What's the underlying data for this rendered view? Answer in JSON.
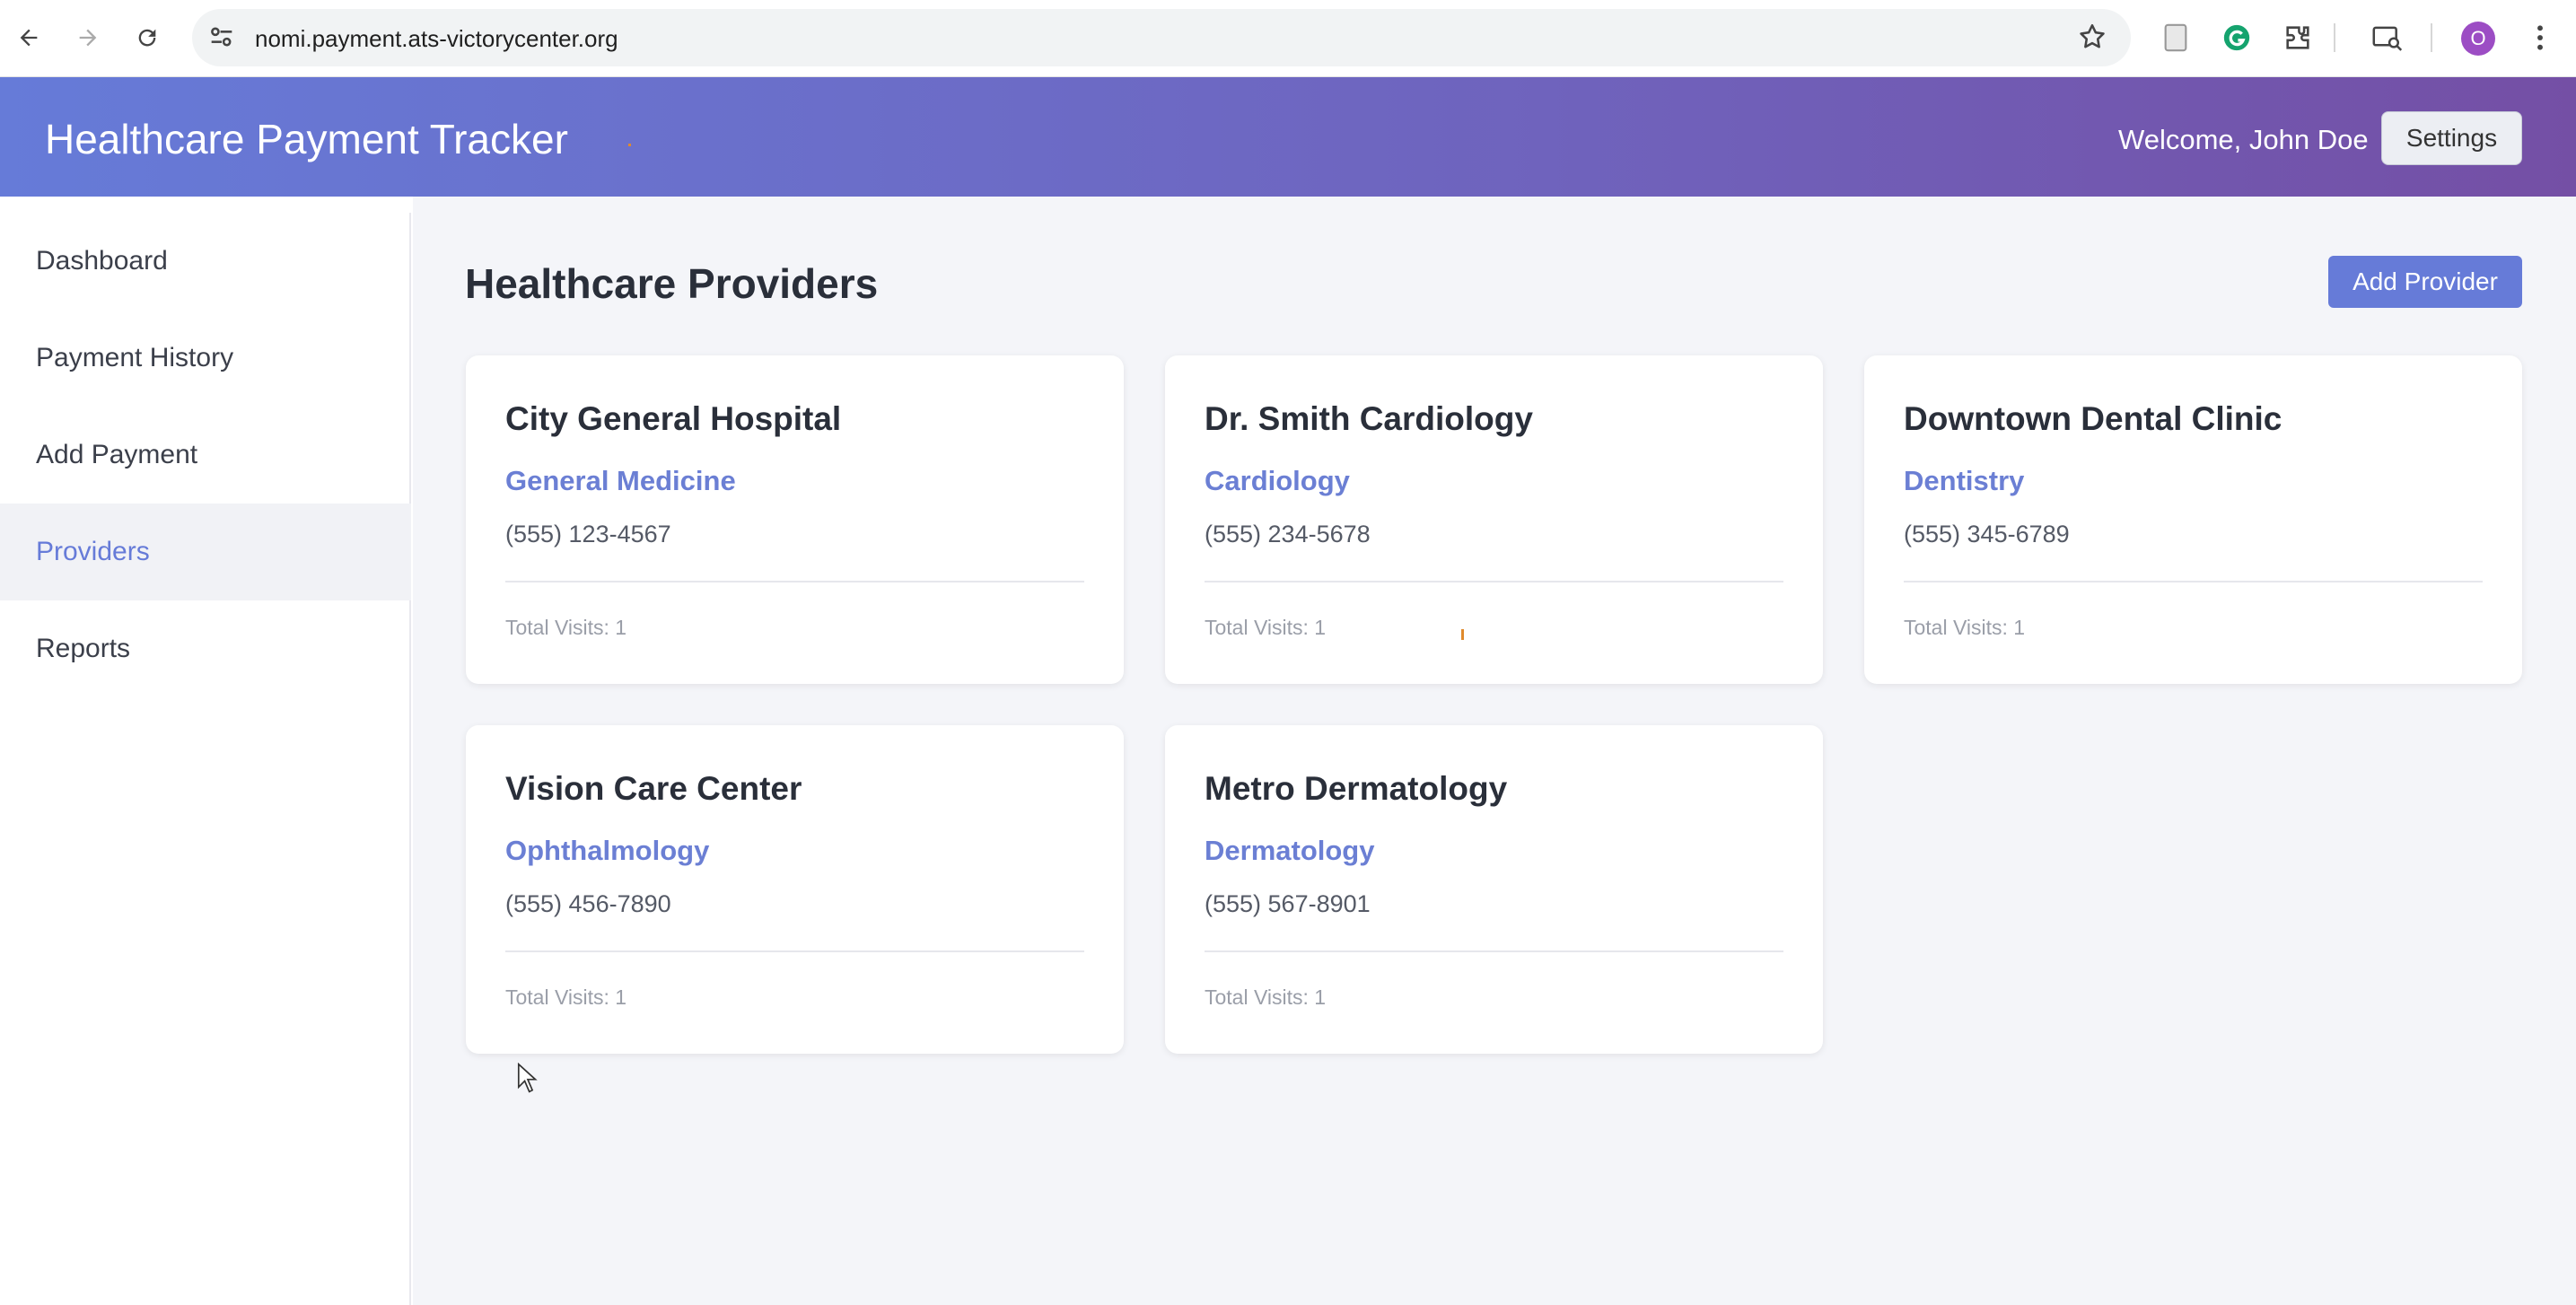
{
  "browser": {
    "url": "nomi.payment.ats-victorycenter.org",
    "profile_initial": "O"
  },
  "header": {
    "title": "Healthcare Payment Tracker",
    "welcome": "Welcome, John Doe",
    "settings_label": "Settings"
  },
  "sidebar": {
    "items": [
      {
        "label": "Dashboard",
        "active": false
      },
      {
        "label": "Payment History",
        "active": false
      },
      {
        "label": "Add Payment",
        "active": false
      },
      {
        "label": "Providers",
        "active": true
      },
      {
        "label": "Reports",
        "active": false
      }
    ]
  },
  "main": {
    "title": "Healthcare Providers",
    "add_button": "Add Provider",
    "providers": [
      {
        "name": "City General Hospital",
        "specialty": "General Medicine",
        "phone": "(555) 123-4567",
        "visits": "Total Visits: 1"
      },
      {
        "name": "Dr. Smith Cardiology",
        "specialty": "Cardiology",
        "phone": "(555) 234-5678",
        "visits": "Total Visits: 1"
      },
      {
        "name": "Downtown Dental Clinic",
        "specialty": "Dentistry",
        "phone": "(555) 345-6789",
        "visits": "Total Visits: 1"
      },
      {
        "name": "Vision Care Center",
        "specialty": "Ophthalmology",
        "phone": "(555) 456-7890",
        "visits": "Total Visits: 1"
      },
      {
        "name": "Metro Dermatology",
        "specialty": "Dermatology",
        "phone": "(555) 567-8901",
        "visits": "Total Visits: 1"
      }
    ]
  },
  "colors": {
    "accent": "#667bd8",
    "header_end": "#744fa5"
  }
}
